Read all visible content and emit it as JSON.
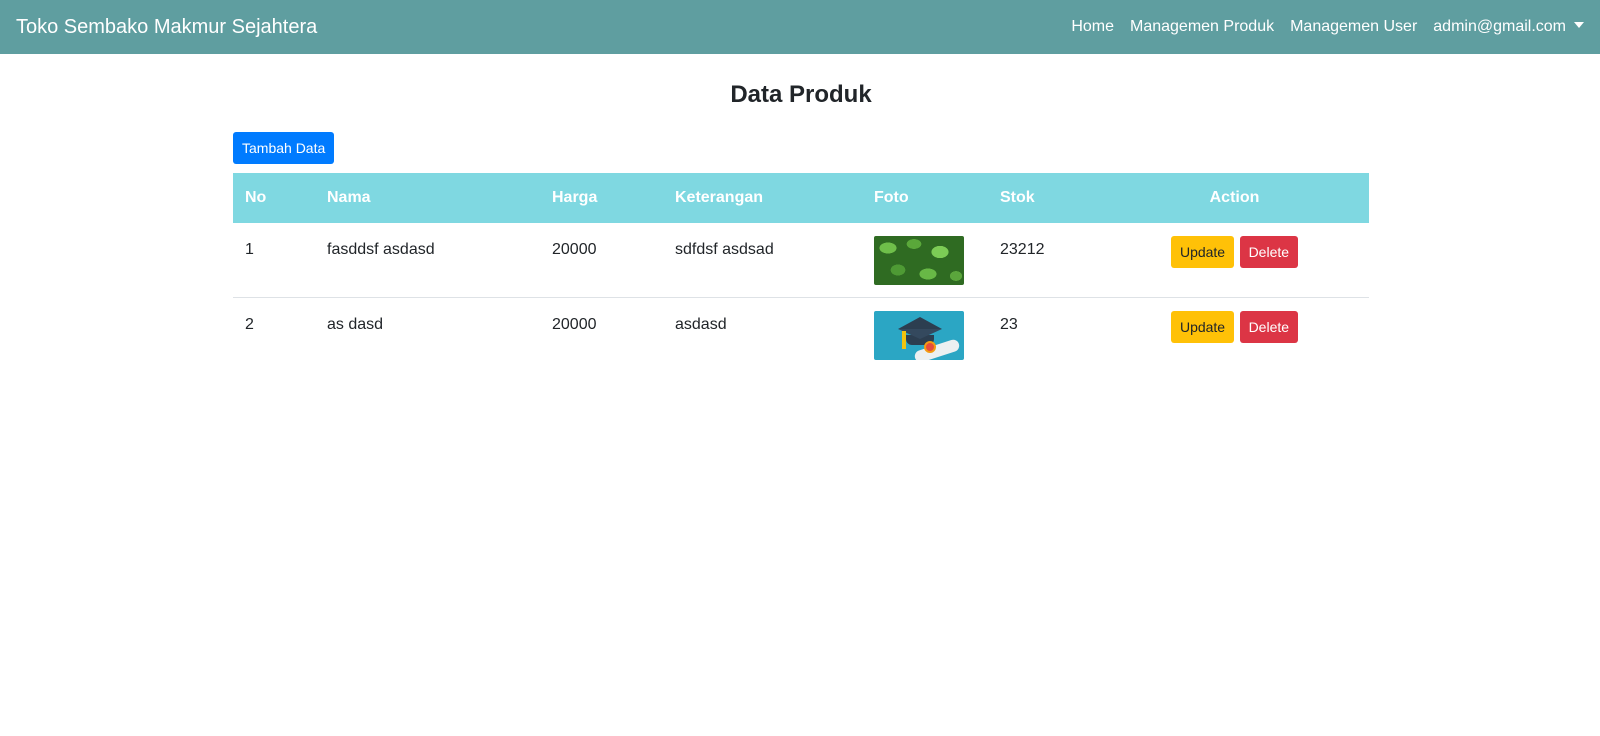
{
  "navbar": {
    "brand": "Toko Sembako Makmur Sejahtera",
    "links": [
      "Home",
      "Managemen Produk",
      "Managemen User"
    ],
    "user": "admin@gmail.com"
  },
  "page": {
    "title": "Data Produk",
    "add_button": "Tambah Data"
  },
  "table": {
    "headers": [
      "No",
      "Nama",
      "Harga",
      "Keterangan",
      "Foto",
      "Stok",
      "Action"
    ],
    "rows": [
      {
        "no": "1",
        "nama": "fasddsf asdasd",
        "harga": "20000",
        "keterangan": "sdfdsf asdsad",
        "foto": "leaves-photo",
        "stok": "23212"
      },
      {
        "no": "2",
        "nama": "as dasd",
        "harga": "20000",
        "keterangan": "asdasd",
        "foto": "graduation-photo",
        "stok": "23"
      }
    ],
    "update_label": "Update",
    "delete_label": "Delete"
  },
  "colors": {
    "navbar": "#5f9ea0",
    "table_header": "#7fd8e1",
    "primary": "#007bff",
    "warning": "#ffc107",
    "danger": "#dc3545"
  }
}
